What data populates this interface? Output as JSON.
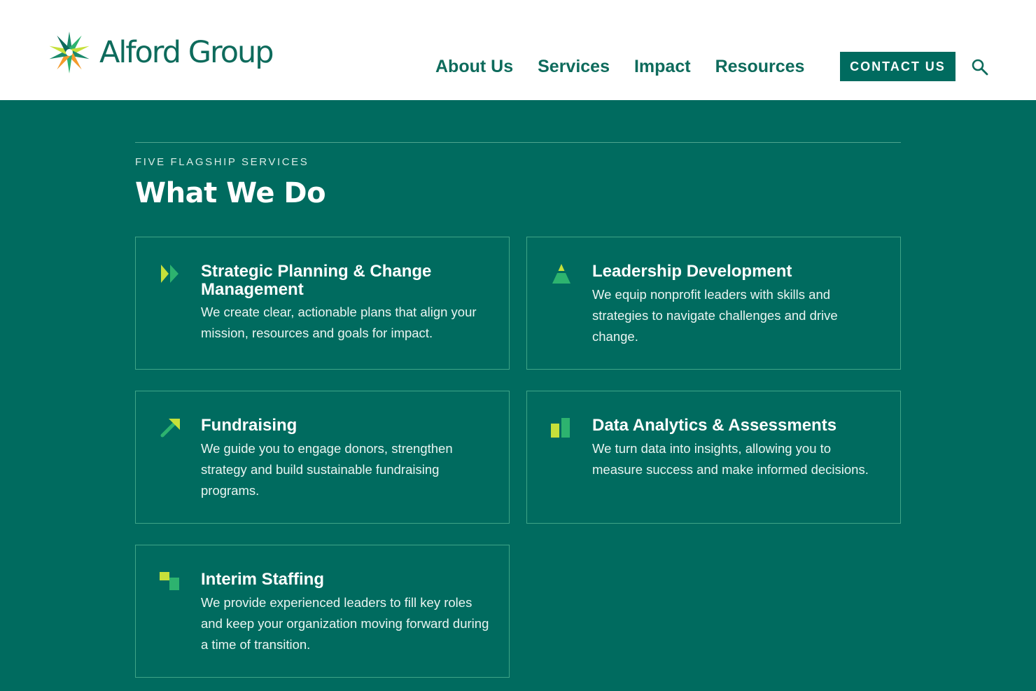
{
  "header": {
    "logo_text": "Alford Group",
    "nav": [
      {
        "label": "About Us"
      },
      {
        "label": "Services"
      },
      {
        "label": "Impact"
      },
      {
        "label": "Resources"
      }
    ],
    "contact_label": "CONTACT US",
    "search_icon": "search-icon"
  },
  "colors": {
    "brand_green": "#006B5F",
    "brand_dark_green": "#0E6B5C",
    "accent_lime": "#C6E03A",
    "accent_green": "#2DB36F",
    "card_border": "#3FA487"
  },
  "section": {
    "eyebrow": "FIVE FLAGSHIP SERVICES",
    "heading": "What We Do",
    "cards": [
      {
        "icon": "double-chevron-icon",
        "title": "Strategic Planning & Change Management",
        "description": "We create clear, actionable plans that align your mission, resources and goals for impact."
      },
      {
        "icon": "pyramid-icon",
        "title": "Leadership Development",
        "description": "We equip nonprofit leaders with skills and strategies to navigate challenges and drive change."
      },
      {
        "icon": "arrow-up-right-icon",
        "title": "Fundraising",
        "description": "We guide you to engage donors, strengthen strategy and build sustainable fundraising programs."
      },
      {
        "icon": "bar-chart-icon",
        "title": "Data Analytics & Assessments",
        "description": "We turn data into insights, allowing you to measure success and make informed decisions."
      },
      {
        "icon": "squares-icon",
        "title": "Interim Staffing",
        "description": "We provide experienced leaders to fill key roles and keep your organization moving forward during a time of transition."
      }
    ]
  }
}
